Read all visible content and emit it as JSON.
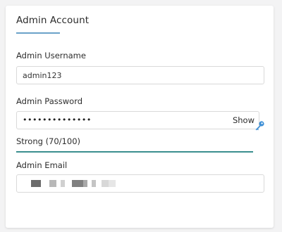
{
  "card": {
    "title": "Admin Account"
  },
  "fields": {
    "username": {
      "label": "Admin Username",
      "value": "admin123"
    },
    "password": {
      "label": "Admin Password",
      "masked_value": "••••••••••••••",
      "show_label": "Show",
      "key_icon": "key-icon"
    },
    "strength": {
      "text": "Strong (70/100)",
      "score": 70,
      "max": 100,
      "color": "#3a8f8f"
    },
    "email": {
      "label": "Admin Email",
      "obscured": true
    }
  },
  "colors": {
    "title_underline": "#6aa2c9",
    "key_icon": "#3d8fd6"
  }
}
